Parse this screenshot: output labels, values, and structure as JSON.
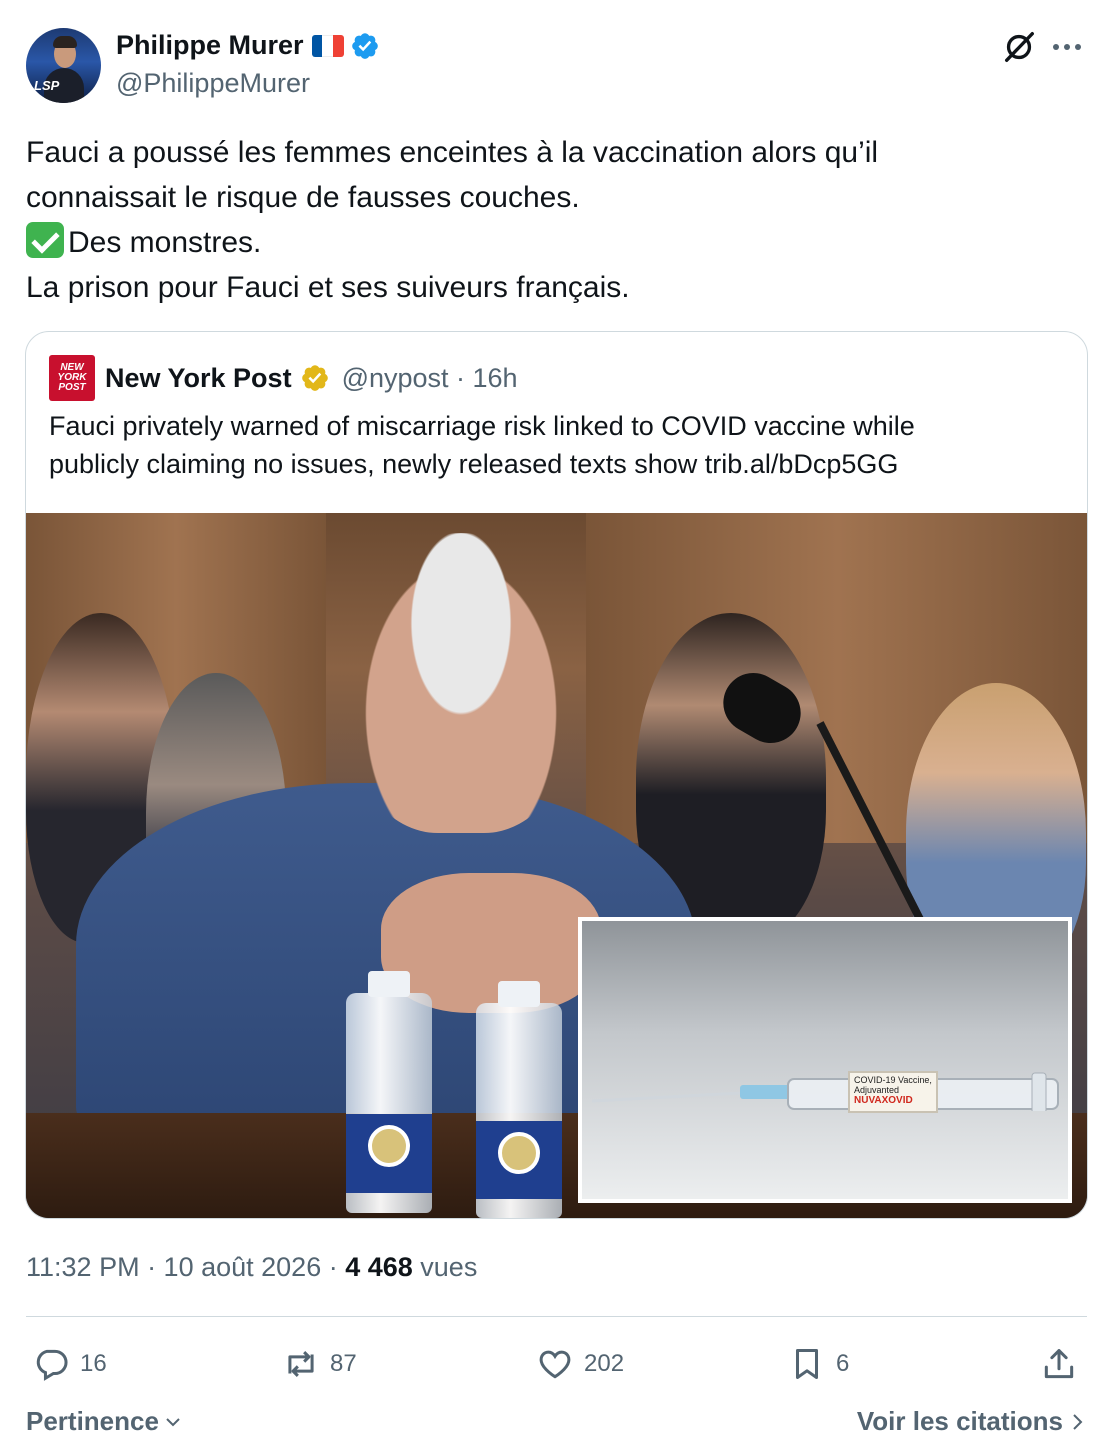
{
  "author": {
    "display_name": "Philippe Murer",
    "handle": "@PhilippeMurer",
    "flag_colors": [
      "#0055a4",
      "#ffffff",
      "#ef4135"
    ],
    "verified_color": "#1d9bf0"
  },
  "tweet": {
    "lines": [
      "Fauci a poussé les femmes enceintes à la vaccination alors qu’il",
      "connaissait le risque de fausses couches.",
      "Des monstres.",
      "La prison pour Fauci et ses suiveurs français."
    ]
  },
  "quote": {
    "logo_text": [
      "NEW",
      "YORK",
      "POST"
    ],
    "display_name": "New York Post",
    "handle_time": "@nypost · 16h",
    "badge_color": "#e2b719",
    "lines": [
      "Fauci privately warned of miscarriage risk linked to COVID vaccine while",
      "publicly claiming no issues, newly released texts show trib.al/bDcp5GG"
    ],
    "inset_label": [
      "COVID-19 Vaccine,",
      "Adjuvanted",
      "NUVAXOVID"
    ]
  },
  "meta": {
    "time_date": "11:32 PM · 10 août 2026 · ",
    "views_count": "4 468",
    "views_label": " vues"
  },
  "actions": {
    "replies": "16",
    "reposts": "87",
    "likes": "202",
    "bookmarks": "6"
  },
  "footer": {
    "sort_label": "Pertinence",
    "quotes_link": "Voir les citations"
  }
}
